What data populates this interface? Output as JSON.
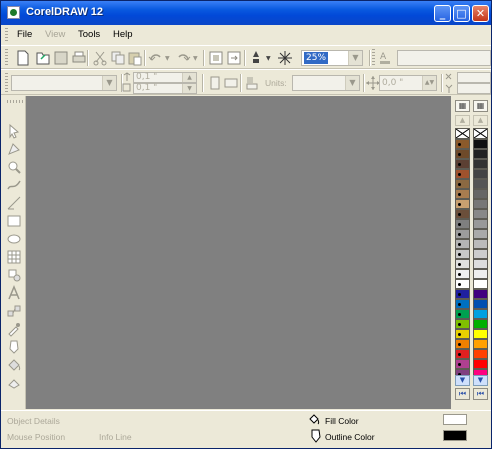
{
  "window": {
    "title": "CorelDRAW 12"
  },
  "title_buttons": {
    "minimize": "_",
    "maximize": "□",
    "close": "✕"
  },
  "menu": [
    {
      "label": "File",
      "enabled": true
    },
    {
      "label": "View",
      "enabled": false
    },
    {
      "label": "Tools",
      "enabled": true
    },
    {
      "label": "Help",
      "enabled": true
    }
  ],
  "standard_toolbar": {
    "zoom_value": "25%"
  },
  "property_bar": {
    "nudge_top": "0,1 \"",
    "nudge_bottom": "0,1 \"",
    "units_label": "Units:",
    "nudge_offset": "0,0 \""
  },
  "palette": {
    "left_colors": [
      "#8b5a2b",
      "#6e4a2a",
      "#5c4033",
      "#a0522d",
      "#8b6942",
      "#a87c4f",
      "#c8a070",
      "#6b4f3a",
      "#7f7f7f",
      "#9c9c9c",
      "#b4b4b4",
      "#c8c8c8",
      "#e0e0e0",
      "#f0f0f0",
      "#ffffff",
      "#2020a0",
      "#0070c0",
      "#00a050",
      "#80c000",
      "#e8d000",
      "#f08000",
      "#e02020",
      "#b04090",
      "#804080"
    ],
    "right_colors": [
      "#111111",
      "#222222",
      "#333333",
      "#444444",
      "#555555",
      "#666666",
      "#777777",
      "#888888",
      "#999999",
      "#aaaaaa",
      "#bbbbbb",
      "#cccccc",
      "#dddddd",
      "#eeeeee",
      "#ffffff",
      "#400080",
      "#0050b0",
      "#00a0e0",
      "#00b000",
      "#ffff00",
      "#ffa000",
      "#ff4000",
      "#ff0000",
      "#ff0080"
    ]
  },
  "status": {
    "object_details": "Object Details",
    "mouse_position": "Mouse Position",
    "info_line": "Info Line",
    "fill_label": "Fill Color",
    "outline_label": "Outline Color",
    "fill_color": "#ffffff",
    "outline_color": "#000000"
  }
}
